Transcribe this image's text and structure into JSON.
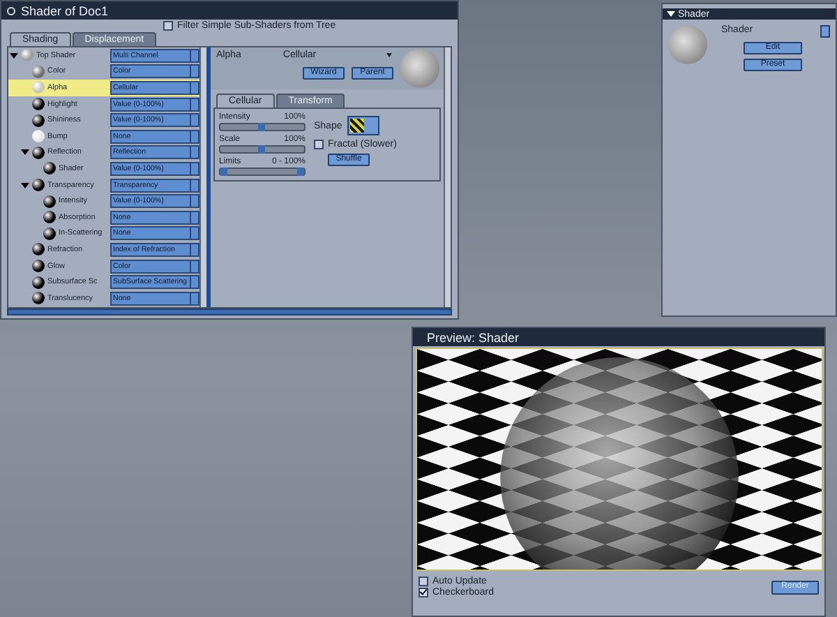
{
  "shader_window": {
    "title": "Shader of Doc1",
    "filter": {
      "label": "Filter Simple Sub-Shaders from Tree",
      "checked": false
    },
    "tabs": [
      {
        "label": "Shading",
        "selected": true
      },
      {
        "label": "Displacement",
        "selected": false
      }
    ],
    "tree": [
      {
        "name": "Top Shader",
        "value": "Multi Channel",
        "color": "#9c9c9c",
        "selected": false,
        "expanded": true,
        "children": [
          {
            "name": "Color",
            "value": "Color",
            "color": "#6e6e6e",
            "selected": false
          },
          {
            "name": "Alpha",
            "value": "Cellular",
            "color": "#c8c8b0",
            "selected": true
          },
          {
            "name": "Highlight",
            "value": "Value (0-100%)",
            "color": "#000000",
            "selected": false
          },
          {
            "name": "Shininess",
            "value": "Value (0-100%)",
            "color": "#000000",
            "selected": false
          },
          {
            "name": "Bump",
            "value": "None",
            "color": "#e8e8e8",
            "selected": false
          },
          {
            "name": "Reflection",
            "value": "Reflection",
            "color": "#000000",
            "selected": false,
            "expanded": true,
            "children": [
              {
                "name": "Shader",
                "value": "Value (0-100%)",
                "color": "#000000",
                "selected": false
              }
            ]
          },
          {
            "name": "Transparency",
            "value": "Transparency",
            "color": "#000000",
            "selected": false,
            "expanded": true,
            "children": [
              {
                "name": "Intensity",
                "value": "Value (0-100%)",
                "color": "#000000",
                "selected": false
              },
              {
                "name": "Absorption",
                "value": "None",
                "color": "#000000",
                "selected": false
              },
              {
                "name": "In-Scattering",
                "value": "None",
                "color": "#000000",
                "selected": false
              }
            ]
          },
          {
            "name": "Refraction",
            "value": "Index of Refraction",
            "color": "#000000",
            "selected": false
          },
          {
            "name": "Glow",
            "value": "Color",
            "color": "#000000",
            "selected": false
          },
          {
            "name": "Subsurface Sc",
            "value": "SubSurface Scattering",
            "color": "#000000",
            "selected": false
          },
          {
            "name": "Translucency",
            "value": "None",
            "color": "#000000",
            "selected": false
          }
        ]
      }
    ]
  },
  "editor": {
    "channel": "Alpha",
    "shader": "Cellular",
    "buttons": [
      "Wizard",
      "Parent"
    ],
    "tabs": [
      {
        "label": "Cellular",
        "selected": true
      },
      {
        "label": "Transform",
        "selected": false
      }
    ],
    "sliders": [
      {
        "kind": "slider",
        "label": "Intensity",
        "reading": "100%",
        "level": 0.5
      },
      {
        "kind": "slider",
        "label": "Scale",
        "reading": "100%",
        "level": 0.5
      },
      {
        "kind": "range",
        "label": "Limits",
        "reading": "0 - 100%"
      }
    ],
    "shape": {
      "label": "Shape"
    },
    "fractal": {
      "label": "Fractal (Slower)",
      "checked": false
    },
    "shuffle": "Shuffle"
  },
  "shader_panel": {
    "header": "Shader",
    "label": "Shader",
    "buttons": [
      "Edit",
      "Preset"
    ]
  },
  "preview": {
    "title": "Preview: Shader",
    "options": [
      {
        "label": "Auto Update",
        "checked": false
      },
      {
        "label": "Checkerboard",
        "checked": true
      }
    ],
    "render_button": "Render"
  }
}
